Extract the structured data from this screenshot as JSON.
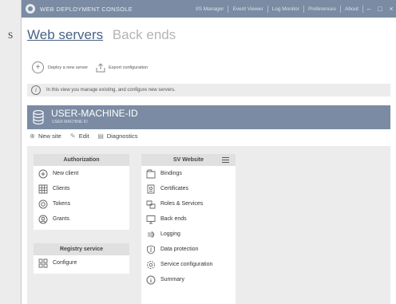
{
  "background_letter": "s",
  "window": {
    "title": "WEB DEPLOYMENT CONSOLE",
    "menu": [
      "IIS Manager",
      "Event Viewer",
      "Log Monitor",
      "Preferences",
      "About"
    ],
    "controls": {
      "minimize": "–",
      "maximize": "□",
      "close": "×"
    }
  },
  "tabs": [
    {
      "label": "Web servers",
      "active": true
    },
    {
      "label": "Back ends",
      "active": false
    }
  ],
  "actions": {
    "deploy": "Deploy a new server",
    "export": "Export configuration"
  },
  "info_text": "In this view you manage existing, and configure new servers.",
  "machine": {
    "name": "USER-MACHINE-ID",
    "subtitle": "USER MACHINE ID"
  },
  "subactions": {
    "new_site": "New site",
    "edit": "Edit",
    "diagnostics": "Diagnostics"
  },
  "authorization": {
    "header": "Authorization",
    "items": [
      {
        "label": "New client",
        "icon": "plus-circle-icon"
      },
      {
        "label": "Clients",
        "icon": "grid-icon"
      },
      {
        "label": "Tokens",
        "icon": "token-icon"
      },
      {
        "label": "Grants",
        "icon": "grant-icon"
      }
    ]
  },
  "registry": {
    "header": "Registry service",
    "items": [
      {
        "label": "Configure",
        "icon": "configure-icon"
      }
    ]
  },
  "website": {
    "header": "SV Website",
    "items": [
      {
        "label": "Bindings",
        "icon": "bindings-icon"
      },
      {
        "label": "Certificates",
        "icon": "certificate-icon"
      },
      {
        "label": "Roles & Services",
        "icon": "roles-icon"
      },
      {
        "label": "Back ends",
        "icon": "monitor-icon"
      },
      {
        "label": "Logging",
        "icon": "logging-icon"
      },
      {
        "label": "Data protection",
        "icon": "shield-icon"
      },
      {
        "label": "Service configuration",
        "icon": "gear-icon"
      },
      {
        "label": "Summary",
        "icon": "info-icon"
      }
    ]
  }
}
